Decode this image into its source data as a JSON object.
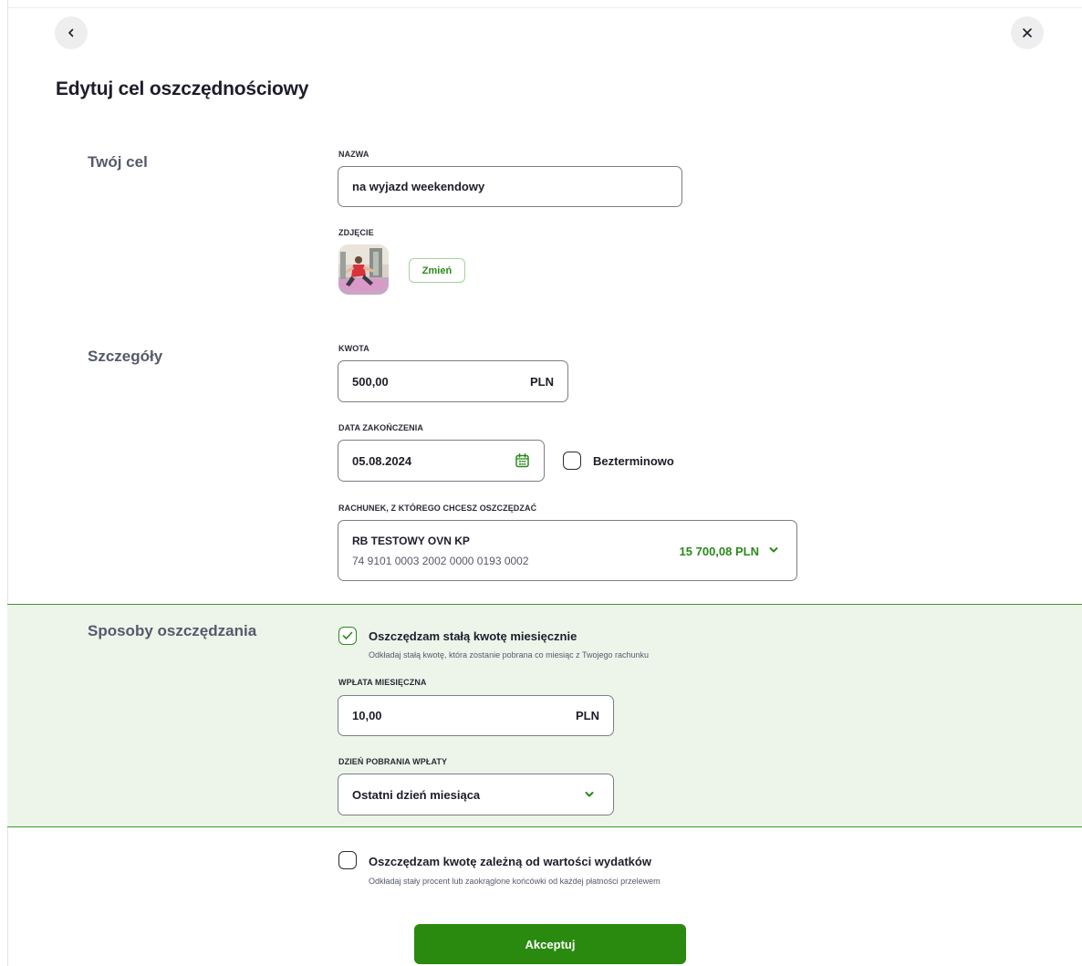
{
  "header": {
    "back_icon": "chevron-left-icon",
    "close_icon": "close-icon",
    "title": "Edytuj cel oszczędnościowy"
  },
  "goal_section": {
    "title": "Twój cel",
    "name_label": "NAZWA",
    "name_value": "na wyjazd weekendowy",
    "photo_label": "ZDJĘCIE",
    "change_button": "Zmień"
  },
  "details_section": {
    "title": "Szczegóły",
    "amount_label": "KWOTA",
    "amount_value": "500,00",
    "amount_currency": "PLN",
    "end_date_label": "DATA ZAKOŃCZENIA",
    "end_date_value": "05.08.2024",
    "calendar_icon": "calendar-icon",
    "indefinite_label": "Bezterminowo",
    "indefinite_checked": false,
    "account_label": "RACHUNEK, Z KTÓREGO CHCESZ OSZCZĘDZAĆ",
    "account": {
      "name": "RB TESTOWY OVN KP",
      "number": "74 9101 0003 2002 0000 0193 0002",
      "balance": "15 700,08 PLN"
    }
  },
  "saving_methods": {
    "title": "Sposoby oszczędzania",
    "fixed": {
      "checked": true,
      "label": "Oszczędzam stałą kwotę miesięcznie",
      "description": "Odkładaj stałą kwotę, która zostanie pobrana co miesiąc z Twojego rachunku",
      "monthly_label": "WPŁATA MIESIĘCZNA",
      "monthly_value": "10,00",
      "monthly_currency": "PLN",
      "day_label": "DZIEŃ POBRANIA WPŁATY",
      "day_value": "Ostatni dzień miesiąca"
    },
    "expense_based": {
      "checked": false,
      "label": "Oszczędzam kwotę zależną od wartości wydatków",
      "description": "Odkładaj stały procent lub zaokrąglone końcówki od każdej płatności przelewem"
    }
  },
  "accept_button": "Akceptuj",
  "colors": {
    "accent_green": "#2a8a0f",
    "band_background": "#edf5eb",
    "band_border": "#3d9a2f"
  }
}
